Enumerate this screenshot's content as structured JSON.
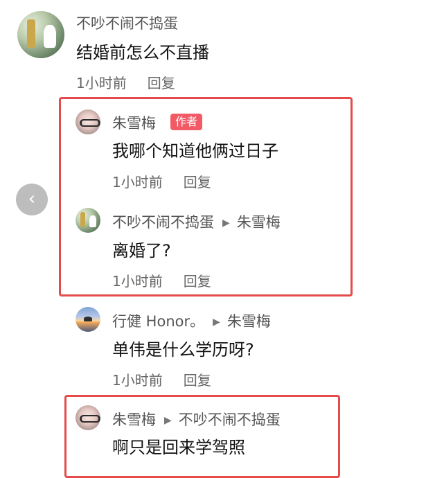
{
  "comments": [
    {
      "author": "不吵不闹不捣蛋",
      "text": "结婚前怎么不直播",
      "time": "1小时前",
      "reply": "回复",
      "avatar_icon": "park-swing-avatar-icon"
    }
  ],
  "replies": [
    {
      "author": "朱雪梅",
      "badge": "作者",
      "text": "我哪个知道他俩过日子",
      "time": "1小时前",
      "reply": "回复",
      "avatar_icon": "girl-glasses-avatar-icon"
    },
    {
      "author": "不吵不闹不捣蛋",
      "reply_to": "朱雪梅",
      "text": "离婚了?",
      "time": "1小时前",
      "reply": "回复",
      "avatar_icon": "park-swing-avatar-icon"
    },
    {
      "author": "行健 Honor。",
      "reply_to": "朱雪梅",
      "text": "单伟是什么学历呀?",
      "time": "1小时前",
      "reply": "回复",
      "avatar_icon": "sunset-avatar-icon"
    },
    {
      "author": "朱雪梅",
      "reply_to": "不吵不闹不捣蛋",
      "text": "啊只是回来学驾照",
      "avatar_icon": "girl-glasses-avatar-icon"
    }
  ],
  "ui": {
    "back_icon": "chevron-left-icon",
    "reply_arrow_icon": "triangle-right-icon",
    "highlight_color": "#e54b4b",
    "badge_color": "#f25a66"
  }
}
